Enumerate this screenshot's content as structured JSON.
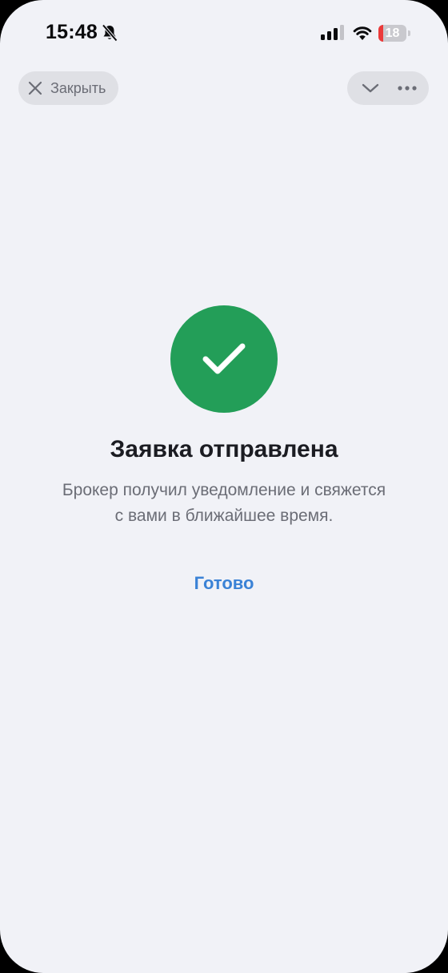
{
  "status_bar": {
    "time": "15:48",
    "battery_level": "18",
    "battery_fraction": 0.18,
    "icons": [
      "bell-muted-icon",
      "cellular-signal-icon",
      "wifi-icon",
      "battery-icon"
    ]
  },
  "top_bar": {
    "close_label": "Закрыть",
    "close_icon": "close-icon",
    "chevron_icon": "chevron-down-icon",
    "more_icon": "more-icon"
  },
  "content": {
    "status_icon": "checkmark-icon",
    "title": "Заявка отправлена",
    "subtitle_line1": "Брокер получил уведомление и свяжется",
    "subtitle_line2": "с вами в ближайшее время.",
    "done_label": "Готово"
  },
  "colors": {
    "background": "#f1f2f7",
    "success": "#239e58",
    "accent": "#3a82d6",
    "battery_low": "#eb3a3a"
  }
}
